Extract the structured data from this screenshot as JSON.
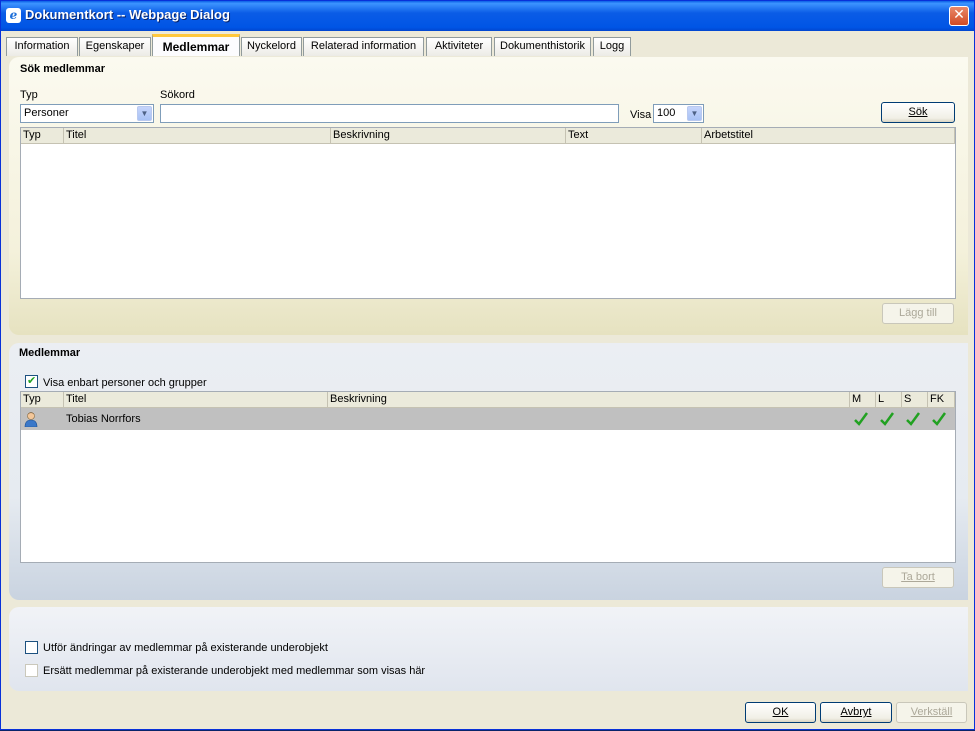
{
  "window": {
    "title": "Dokumentkort -- Webpage Dialog",
    "close_glyph": "✕"
  },
  "tabs": [
    {
      "label": "Information"
    },
    {
      "label": "Egenskaper"
    },
    {
      "label": "Medlemmar"
    },
    {
      "label": "Nyckelord"
    },
    {
      "label": "Relaterad information"
    },
    {
      "label": "Aktiviteter"
    },
    {
      "label": "Dokumenthistorik"
    },
    {
      "label": "Logg"
    }
  ],
  "search": {
    "title": "Sök medlemmar",
    "type_label": "Typ",
    "type_value": "Personer",
    "keyword_label": "Sökord",
    "keyword_value": "",
    "show_label": "Visa",
    "show_value": "100",
    "search_button": "Sök",
    "columns": [
      "Typ",
      "Titel",
      "Beskrivning",
      "Text",
      "Arbetstitel"
    ],
    "add_button": "Lägg till"
  },
  "members": {
    "title": "Medlemmar",
    "filter_checkbox_label": "Visa enbart personer och grupper",
    "filter_checked": true,
    "columns": [
      "Typ",
      "Titel",
      "Beskrivning",
      "M",
      "L",
      "S",
      "FK"
    ],
    "rows": [
      {
        "type_icon": "person-icon",
        "title": "Tobias Norrfors",
        "description": "",
        "M": true,
        "L": true,
        "S": true,
        "FK": true
      }
    ],
    "remove_button": "Ta bort"
  },
  "options": {
    "apply_children_label": "Utför ändringar av medlemmar på existerande underobjekt",
    "apply_children_checked": false,
    "replace_children_label": "Ersätt medlemmar på existerande underobjekt med medlemmar som visas här",
    "replace_children_checked": false
  },
  "footer": {
    "ok": "OK",
    "cancel": "Avbryt",
    "apply": "Verkställ"
  },
  "colors": {
    "titlebar": "#0055e5",
    "tab_active_accent": "#ffc83c",
    "check_green": "#21a121"
  }
}
